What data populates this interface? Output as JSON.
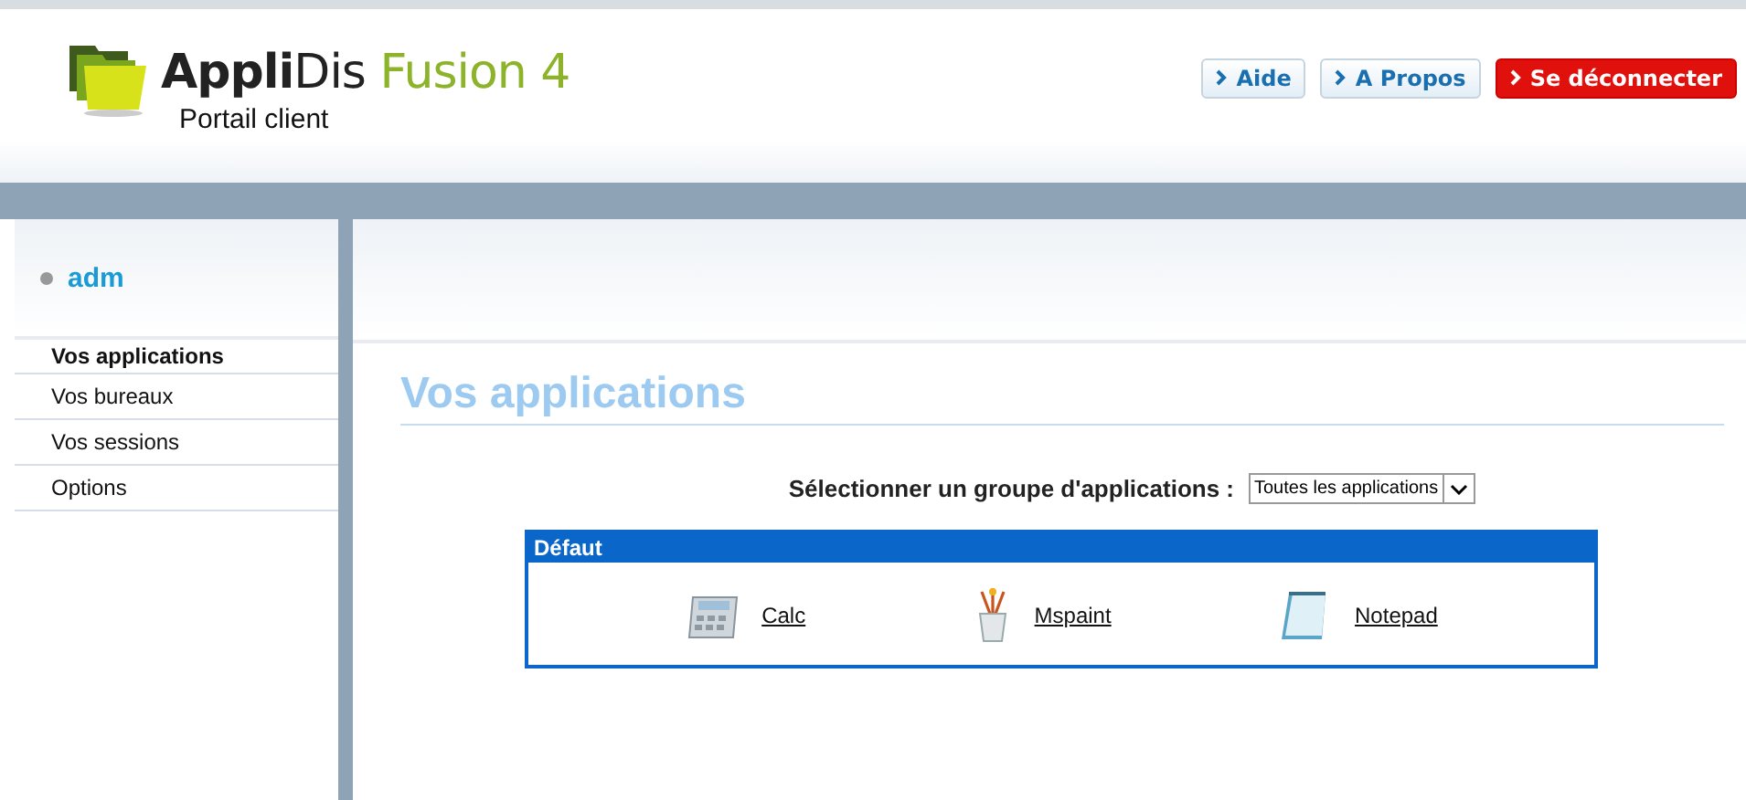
{
  "header": {
    "brand": {
      "name_bold": "Appli",
      "name_regular": "Dis",
      "product": "Fusion 4",
      "subtitle": "Portail client"
    },
    "buttons": [
      {
        "label": "Aide",
        "kind": "normal"
      },
      {
        "label": "A Propos",
        "kind": "normal"
      },
      {
        "label": "Se déconnecter",
        "kind": "danger"
      }
    ]
  },
  "sidebar": {
    "user": "adm",
    "items": [
      {
        "label": "Vos applications",
        "selected": true
      },
      {
        "label": "Vos bureaux",
        "selected": false
      },
      {
        "label": "Vos sessions",
        "selected": false
      },
      {
        "label": "Options",
        "selected": false
      }
    ]
  },
  "main": {
    "title": "Vos applications",
    "group_label": "Sélectionner un groupe d'applications :",
    "group_select": "Toutes les applications",
    "group": {
      "title": "Défaut",
      "apps": [
        {
          "label": "Calc",
          "kind": "calc"
        },
        {
          "label": "Mspaint",
          "kind": "paint"
        },
        {
          "label": "Notepad",
          "kind": "notepad"
        }
      ]
    }
  }
}
